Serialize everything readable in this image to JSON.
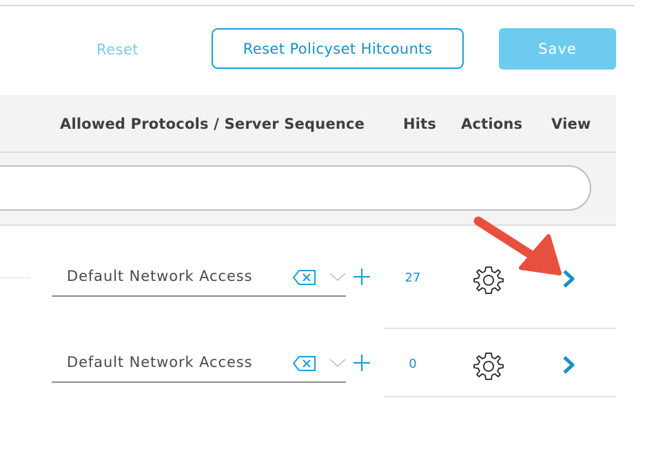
{
  "toolbar": {
    "reset_label": "Reset",
    "reset_hitcounts_label": "Reset Policyset Hitcounts",
    "save_label": "Save"
  },
  "table": {
    "columns": {
      "protocols": "Allowed Protocols / Server Sequence",
      "hits": "Hits",
      "actions": "Actions",
      "view": "View"
    },
    "rows": [
      {
        "protocol": "Default Network Access",
        "hits": "27"
      },
      {
        "protocol": "Default Network Access",
        "hits": "0"
      }
    ]
  },
  "colors": {
    "accent": "#1ba0d7",
    "save_bg": "#6dcbef",
    "annotation_arrow": "#e8503e"
  },
  "icons": [
    "clear-icon",
    "chevron-down-icon",
    "plus-icon",
    "gear-icon",
    "chevron-right-icon"
  ]
}
